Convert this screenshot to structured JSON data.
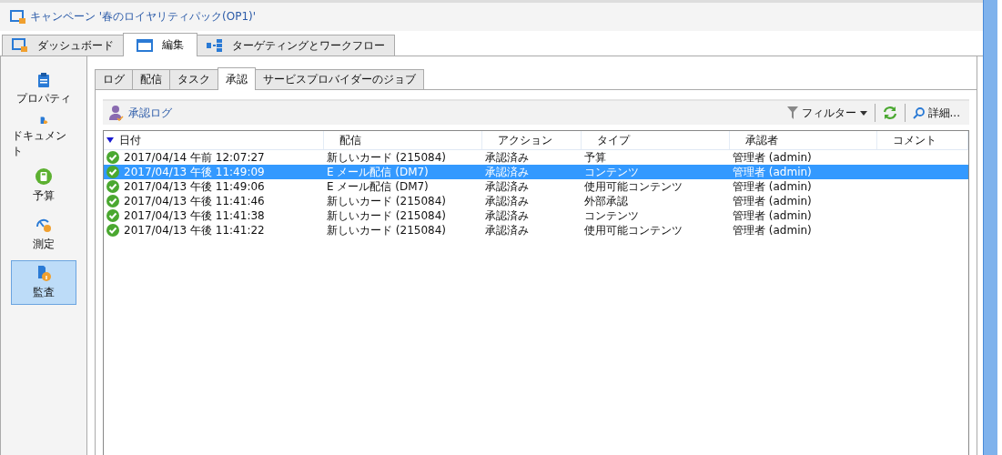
{
  "window": {
    "title": "キャンペーン '春のロイヤリティパック(OP1)'"
  },
  "main_tabs": [
    {
      "label": "ダッシュボード",
      "selected": false
    },
    {
      "label": "編集",
      "selected": true
    },
    {
      "label": "ターゲティングとワークフロー",
      "selected": false
    }
  ],
  "sidebar": {
    "items": [
      {
        "label": "プロパティ",
        "selected": false
      },
      {
        "label": "ドキュメント",
        "selected": false
      },
      {
        "label": "予算",
        "selected": false
      },
      {
        "label": "測定",
        "selected": false
      },
      {
        "label": "監査",
        "selected": true
      }
    ]
  },
  "sub_tabs": [
    {
      "label": "ログ",
      "selected": false
    },
    {
      "label": "配信",
      "selected": false
    },
    {
      "label": "タスク",
      "selected": false
    },
    {
      "label": "承認",
      "selected": true
    },
    {
      "label": "サービスプロバイダーのジョブ",
      "selected": false
    }
  ],
  "toolbar": {
    "title": "承認ログ",
    "filter": "フィルター",
    "details": "詳細..."
  },
  "table": {
    "columns": [
      {
        "label": "日付",
        "sorted": true
      },
      {
        "label": "配信",
        "sorted": false
      },
      {
        "label": "アクション",
        "sorted": false
      },
      {
        "label": "タイプ",
        "sorted": false
      },
      {
        "label": "承認者",
        "sorted": false
      },
      {
        "label": "コメント",
        "sorted": false
      }
    ],
    "rows": [
      {
        "selected": false,
        "cells": [
          "2017/04/14 午前 12:07:27",
          "新しいカード (215084)",
          "承認済み",
          "予算",
          "管理者 (admin)",
          ""
        ]
      },
      {
        "selected": true,
        "cells": [
          "2017/04/13 午後 11:49:09",
          "E メール配信 (DM7)",
          "承認済み",
          "コンテンツ",
          "管理者 (admin)",
          ""
        ]
      },
      {
        "selected": false,
        "cells": [
          "2017/04/13 午後 11:49:06",
          "E メール配信 (DM7)",
          "承認済み",
          "使用可能コンテンツ",
          "管理者 (admin)",
          ""
        ]
      },
      {
        "selected": false,
        "cells": [
          "2017/04/13 午後 11:41:46",
          "新しいカード (215084)",
          "承認済み",
          "外部承認",
          "管理者 (admin)",
          ""
        ]
      },
      {
        "selected": false,
        "cells": [
          "2017/04/13 午後 11:41:38",
          "新しいカード (215084)",
          "承認済み",
          "コンテンツ",
          "管理者 (admin)",
          ""
        ]
      },
      {
        "selected": false,
        "cells": [
          "2017/04/13 午後 11:41:22",
          "新しいカード (215084)",
          "承認済み",
          "使用可能コンテンツ",
          "管理者 (admin)",
          ""
        ]
      }
    ]
  }
}
